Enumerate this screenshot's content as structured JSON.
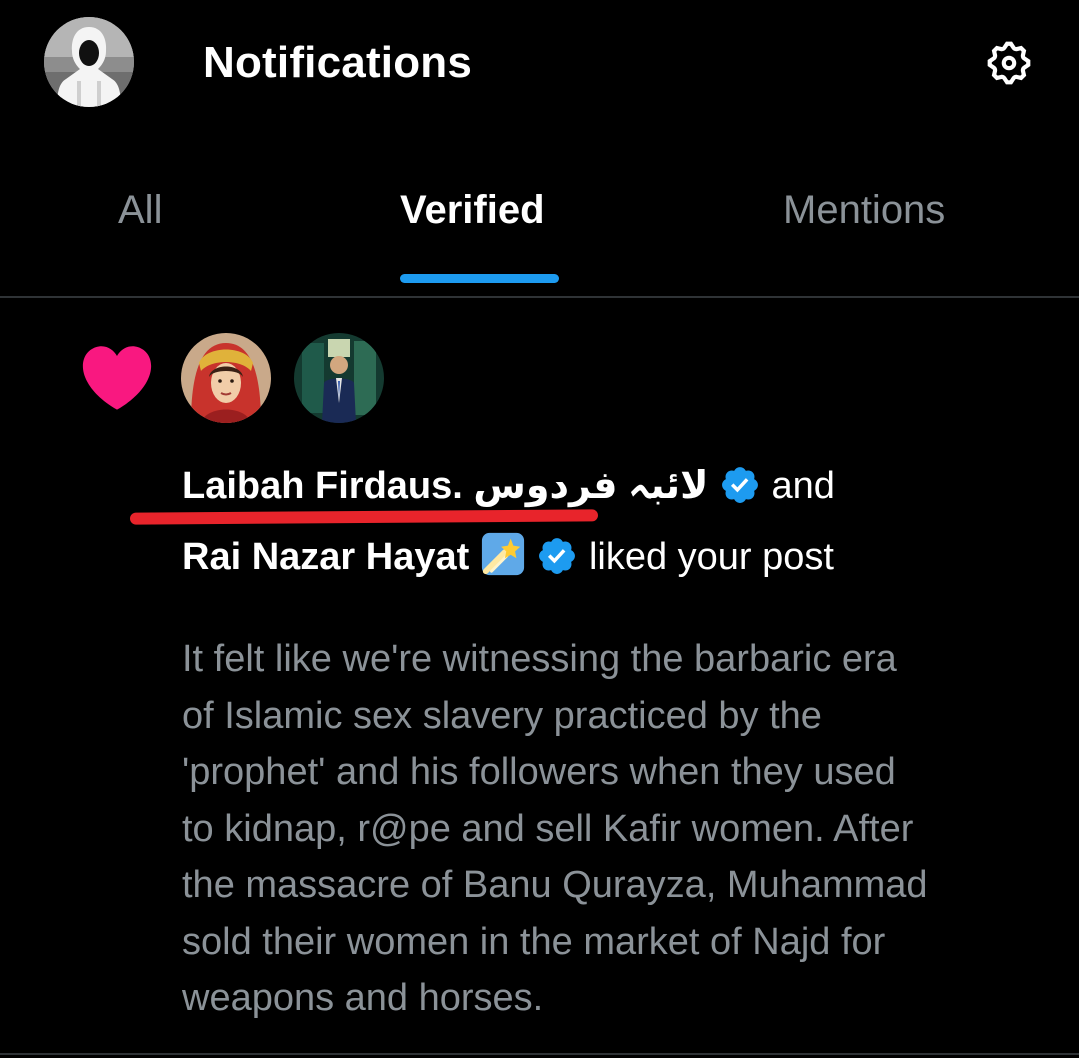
{
  "header": {
    "title": "Notifications"
  },
  "tabs": [
    {
      "label": "All"
    },
    {
      "label": "Verified"
    },
    {
      "label": "Mentions"
    }
  ],
  "active_tab": "Verified",
  "colors": {
    "accent": "#1d9bf0",
    "like_heart": "#f91880",
    "annotation_underline": "#e8242b",
    "secondary_text": "#8b9298"
  },
  "notification": {
    "icon": "heart-icon",
    "user1": {
      "name": "Laibah Firdaus. لائبہ فردوس",
      "badge": "verified-badge-icon"
    },
    "connector": "and",
    "user2": {
      "name": "Rai Nazar Hayat",
      "emoji": "shooting-star-emoji-icon",
      "badge": "verified-badge-icon"
    },
    "action": "liked your post",
    "post_lines": [
      "It felt like we're witnessing the barbaric era",
      "of Islamic sex slavery practiced by the",
      "'prophet' and his followers when they  used",
      "to kidnap, r@pe and sell Kafir women. After",
      "the massacre of Banu Qurayza, Muhammad",
      "sold their women in the market of Najd for",
      "weapons and horses."
    ]
  }
}
